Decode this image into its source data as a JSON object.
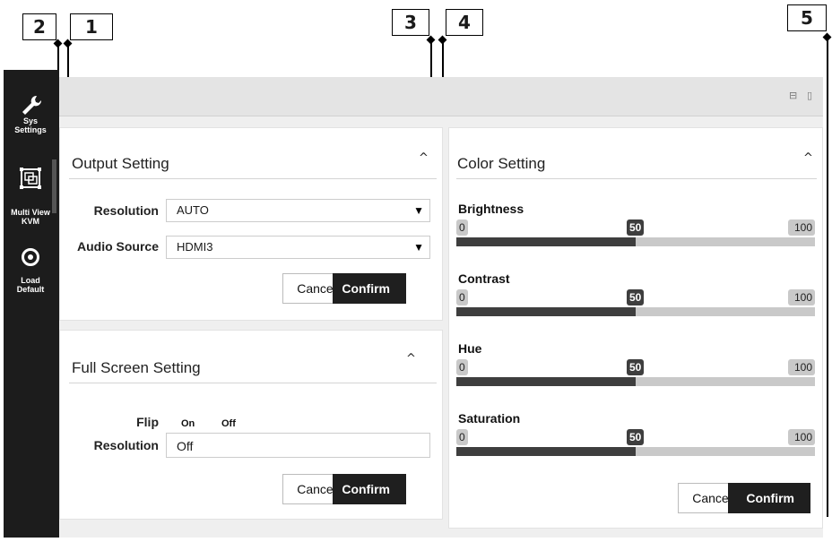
{
  "callouts": [
    "2",
    "1",
    "3",
    "4",
    "5"
  ],
  "sidebar": {
    "items": [
      {
        "label": "Sys\nSettings",
        "icon": "wrench-icon"
      },
      {
        "label": "Multi View\nKVM",
        "icon": "multiview-icon"
      },
      {
        "label": "Load\nDefault",
        "icon": "reset-icon"
      }
    ]
  },
  "window_buttons": {
    "minimize": "⊟",
    "maximize": "▯"
  },
  "output_setting": {
    "title": "Output Setting",
    "chevron": "^",
    "resolution_label": "Resolution",
    "resolution_value": "AUTO",
    "audio_label": "Audio Source",
    "audio_value": "HDMI3",
    "cancel": "Cancel",
    "confirm": "Confirm"
  },
  "full_screen_setting": {
    "title": "Full Screen Setting",
    "chevron": "^",
    "flip_label": "Flip",
    "flip_on": "On",
    "flip_off": "Off",
    "resolution_label": "Resolution",
    "resolution_value": "Off",
    "cancel": "Cancel",
    "confirm": "Confirm"
  },
  "color_setting": {
    "title": "Color Setting",
    "chevron": "^",
    "sliders": [
      {
        "label": "Brightness",
        "min": "0",
        "max": "100",
        "value": "50",
        "fraction": 0.5
      },
      {
        "label": "Contrast",
        "min": "0",
        "max": "100",
        "value": "50",
        "fraction": 0.5
      },
      {
        "label": "Hue",
        "min": "0",
        "max": "100",
        "value": "50",
        "fraction": 0.5
      },
      {
        "label": "Saturation",
        "min": "0",
        "max": "100",
        "value": "50",
        "fraction": 0.5
      }
    ],
    "cancel": "Cancel",
    "confirm": "Confirm"
  },
  "colors": {
    "sidebar": "#1c1c1c",
    "accent_dark": "#1f1f1f",
    "slider_fill": "#3e3e3e",
    "slider_track": "#c9c9c9"
  }
}
